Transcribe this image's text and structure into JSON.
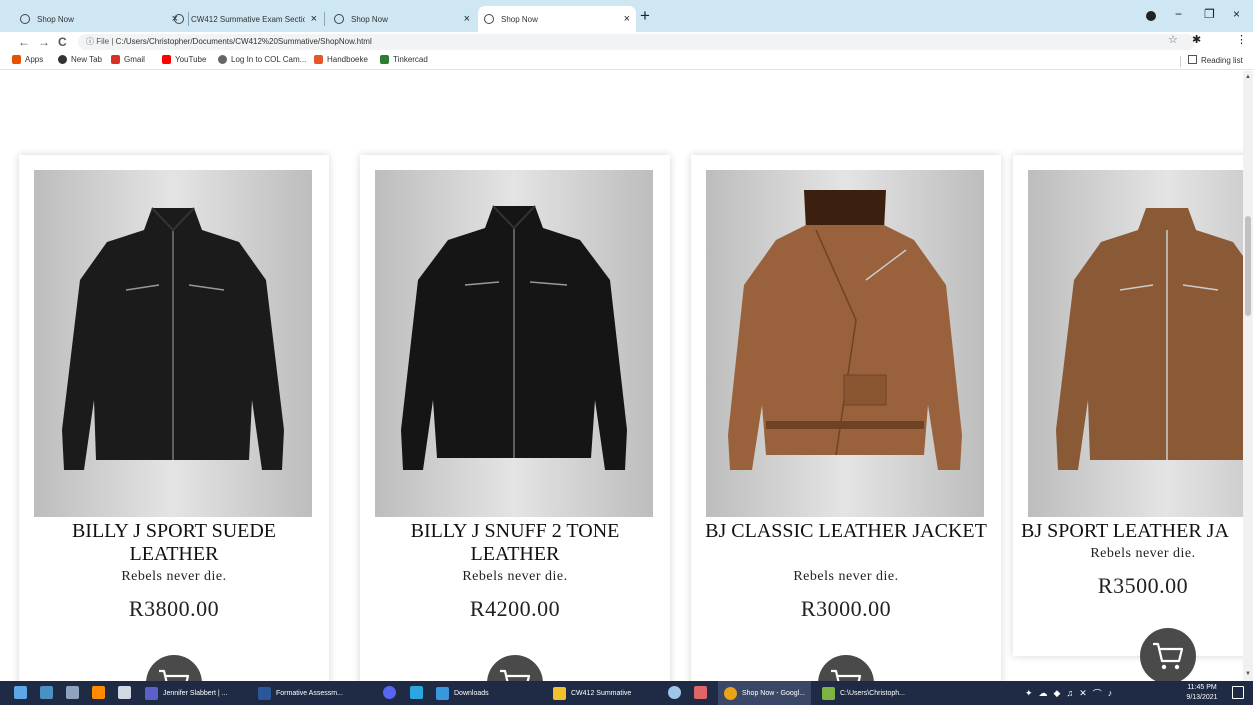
{
  "browser": {
    "tabs": [
      {
        "title": "Shop Now",
        "close": "×",
        "icon": "globe-icon",
        "active": false
      },
      {
        "title": "CW412 Summative Exam Section",
        "close": "×",
        "icon": "globe-icon",
        "active": false
      },
      {
        "title": "Shop Now",
        "close": "×",
        "icon": "globe-icon",
        "active": false
      },
      {
        "title": "Shop Now",
        "close": "×",
        "icon": "globe-icon",
        "active": true
      }
    ],
    "new_tab": "+",
    "window_controls": {
      "minimize": "−",
      "maximize": "❐",
      "close": "×"
    },
    "nav": {
      "back": "←",
      "forward": "→",
      "reload": "C"
    },
    "address": {
      "prefix": "ⓘ File  |  ",
      "url": "C:/Users/Christopher/Documents/CW412%20Summative/ShopNow.html"
    },
    "star": "☆",
    "extensions": "✱",
    "menu": "⋮",
    "bookmarks": [
      {
        "label": "Apps",
        "icon": "apps-grid-icon",
        "color": "#e65100"
      },
      {
        "label": "New Tab",
        "icon": "globe-icon",
        "color": "#333333"
      },
      {
        "label": "Gmail",
        "icon": "gmail-icon",
        "color": "#d93025"
      },
      {
        "label": "YouTube",
        "icon": "youtube-icon",
        "color": "#ff0000"
      },
      {
        "label": "Log In to COL Cam...",
        "icon": "cam-icon",
        "color": "#666666"
      },
      {
        "label": "Handboeke",
        "icon": "handboeke-icon",
        "color": "#e4572e"
      },
      {
        "label": "Tinkercad",
        "icon": "tinkercad-icon",
        "color": "#2e7d32"
      }
    ],
    "reading_list": "Reading list"
  },
  "products": [
    {
      "name": "BILLY J SPORT SUEDE LEATHER",
      "tagline": "Rebels never die.",
      "price": "R3800.00",
      "jacket_color": "#1b1b1b"
    },
    {
      "name": "BILLY J SNUFF 2 TONE LEATHER",
      "tagline": "Rebels never die.",
      "price": "R4200.00",
      "jacket_color": "#151515"
    },
    {
      "name": "BJ CLASSIC LEATHER JACKET",
      "tagline": "Rebels never die.",
      "price": "R3000.00",
      "jacket_color": "#9a623c"
    },
    {
      "name": "BJ SPORT LEATHER JA",
      "tagline": "Rebels never die.",
      "price": "R3500.00",
      "jacket_color": "#8a5a36"
    }
  ],
  "cart_icon": "shopping-cart-icon",
  "taskbar": {
    "items": [
      {
        "label": "Jennifer Slabbert | ...",
        "icon": "teams-icon",
        "color": "#5b5fc7"
      },
      {
        "label": "Formative Assessm...",
        "icon": "word-icon",
        "color": "#2b579a"
      },
      {
        "label": "Downloads",
        "icon": "download-icon",
        "color": "#3a96dd"
      },
      {
        "label": "CW412 Summative",
        "icon": "folder-icon",
        "color": "#f2c12e"
      },
      {
        "label": "Shop Now - Googl...",
        "icon": "chrome-icon",
        "color": "#e8a317"
      },
      {
        "label": "C:\\Users\\Christoph...",
        "icon": "notepad-icon",
        "color": "#7cb342"
      }
    ],
    "time": "11:45 PM",
    "date": "9/13/2021"
  }
}
